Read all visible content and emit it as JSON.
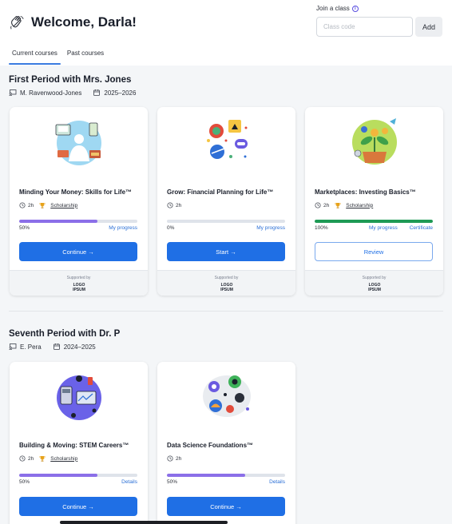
{
  "header": {
    "welcome": "Welcome, Darla!",
    "join_label": "Join a class",
    "class_code_placeholder": "Class code",
    "add_label": "Add"
  },
  "tabs": [
    {
      "label": "Current courses",
      "active": true
    },
    {
      "label": "Past courses",
      "active": false
    }
  ],
  "sections": [
    {
      "title": "First Period with Mrs. Jones",
      "teacher": "M. Ravenwood-Jones",
      "year": "2025–2026",
      "courses": [
        {
          "title": "Minding Your Money: Skills for Life™",
          "duration": "2h",
          "scholarship": "Scholarship",
          "progress_label": "50%",
          "progress": 0.66,
          "bar_color": "#8b6fe8",
          "link": "My progress",
          "link2": "",
          "button": "Continue →",
          "supported_by": "Supported by",
          "logo_text": "LOGO IPSUM"
        },
        {
          "title": "Grow: Financial Planning for Life™",
          "duration": "2h",
          "scholarship": "",
          "progress_label": "0%",
          "progress": 0,
          "bar_color": "#8b6fe8",
          "link": "My progress",
          "link2": "",
          "button": "Start →",
          "supported_by": "Supported by",
          "logo_text": "LOGO IPSUM"
        },
        {
          "title": "Marketplaces: Investing Basics™",
          "duration": "2h",
          "scholarship": "Scholarship",
          "progress_label": "100%",
          "progress": 1.0,
          "bar_color": "#1e9a55",
          "link": "My progress",
          "link2": "Certificate",
          "button": "Review",
          "supported_by": "Supported by",
          "logo_text": "LOGO IPSUM"
        }
      ]
    },
    {
      "title": "Seventh Period with Dr. P",
      "teacher": "E. Pera",
      "year": "2024–2025",
      "courses": [
        {
          "title": "Building & Moving: STEM Careers™",
          "duration": "2h",
          "scholarship": "Scholarship",
          "progress_label": "50%",
          "progress": 0.66,
          "bar_color": "#8b6fe8",
          "link": "Details",
          "button": "Continue →"
        },
        {
          "title": "Data Science Foundations™",
          "duration": "2h",
          "scholarship": "",
          "progress_label": "50%",
          "progress": 0.66,
          "bar_color": "#8b6fe8",
          "link": "Details",
          "button": "Continue →"
        }
      ]
    }
  ],
  "icons": {
    "wave": "waving-hand-icon",
    "info": "info-icon",
    "teacher": "chalkboard-icon",
    "calendar": "calendar-icon",
    "clock": "clock-icon",
    "trophy": "trophy-icon"
  },
  "colors": {
    "primary": "#1f6fe5",
    "progress_purple": "#8b6fe8",
    "progress_green": "#1e9a55",
    "page_bg": "#f4f6f8"
  }
}
